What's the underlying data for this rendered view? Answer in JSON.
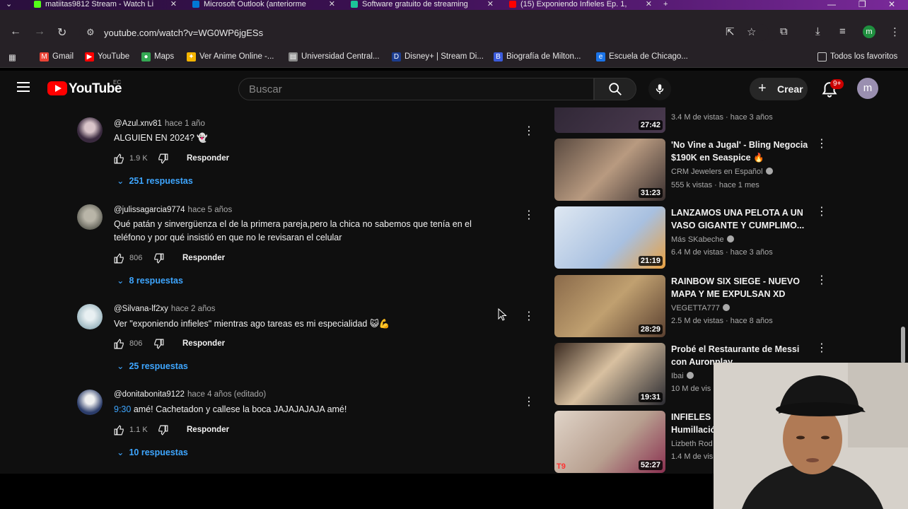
{
  "browser": {
    "tabs": [
      {
        "title": "matiitas9812 Stream - Watch Li",
        "color": "#53fc18"
      },
      {
        "title": "Microsoft Outlook (anteriorme",
        "color": "#0078d4"
      },
      {
        "title": "Software gratuito de streaming",
        "color": "#1cc49a"
      },
      {
        "title": "(15) Exponiendo Infieles Ep. 1,",
        "color": "#ff0000"
      }
    ],
    "url": "youtube.com/watch?v=WG0WP6jgESs",
    "profile_initial": "m",
    "bookmarks": [
      {
        "label": "Gmail",
        "color": "#ea4335"
      },
      {
        "label": "YouTube",
        "color": "#ff0000"
      },
      {
        "label": "Maps",
        "color": "#34a853"
      },
      {
        "label": "Ver Anime Online -...",
        "color": "#f4b400"
      },
      {
        "label": "Universidad Central...",
        "color": "#888888"
      },
      {
        "label": "Disney+ | Stream Di...",
        "color": "#1c3d8f"
      },
      {
        "label": "Biografía de Milton...",
        "color": "#3b5bdb"
      },
      {
        "label": "Escuela de Chicago...",
        "color": "#1a73e8"
      }
    ],
    "all_bookmarks": "Todos los favoritos"
  },
  "youtube": {
    "logo_text": "YouTube",
    "country": "EC",
    "search_placeholder": "Buscar",
    "create_label": "Crear",
    "notif_badge": "9+",
    "avatar_initial": "m"
  },
  "comments": [
    {
      "handle": "@Azul.xnv81",
      "ago": "hace 1 año",
      "text": "ALGUIEN EN 2024? 👻",
      "likes": "1.9 K",
      "reply": "Responder",
      "replies": "251 respuestas",
      "avatar": "#3a2a3f"
    },
    {
      "handle": "@julissagarcia9774",
      "ago": "hace 5 años",
      "text": "Qué patán y sinvergüenza el de la primera pareja,pero la chica no sabemos que tenía en el teléfono y por qué insistió en que no le revisaran el celular",
      "likes": "806",
      "reply": "Responder",
      "replies": "8 respuestas",
      "avatar": "#8a8a80"
    },
    {
      "handle": "@Silvana-lf2xy",
      "ago": "hace 2 años",
      "text": "Ver \"exponiendo infieles\" mientras ago tareas es mi especialidad 😺💪",
      "likes": "806",
      "reply": "Responder",
      "replies": "25 respuestas",
      "avatar": "#9fb9c2"
    },
    {
      "handle": "@donitabonita9122",
      "ago": "hace 4 años (editado)",
      "timestamp": "9:30",
      "text": " amé! Cachetadon y callese la boca JAJAJAJAJA amé!",
      "likes": "1.1 K",
      "reply": "Responder",
      "replies": "10 respuestas",
      "avatar": "#2b3c6a"
    }
  ],
  "videos": [
    {
      "title": "",
      "channel": "",
      "meta": "3.4 M de vistas · hace 3 años",
      "duration": "27:42",
      "thumb": "#3b3340"
    },
    {
      "title": "'No Vine a Jugal' - Bling Negocia $190K en Seaspice 🔥",
      "channel": "CRM Jewelers en Español",
      "meta": "555 k vistas · hace 1 mes",
      "duration": "31:23",
      "thumb": "#6a5a50"
    },
    {
      "title": "LANZAMOS UNA PELOTA A UN VASO GIGANTE Y CUMPLIMO...",
      "channel": "Más SKabeche",
      "meta": "6.4 M de vistas · hace 3 años",
      "duration": "21:19",
      "thumb": "#c9d6e8"
    },
    {
      "title": "RAINBOW SIX SIEGE - NUEVO MAPA Y ME EXPULSAN XD",
      "channel": "VEGETTA777",
      "meta": "2.5 M de vistas · hace 8 años",
      "duration": "28:29",
      "thumb": "#7a5a3a"
    },
    {
      "title": "Probé el Restaurante de Messi con Auronplay",
      "channel": "Ibai",
      "meta": "10 M de vis",
      "duration": "19:31",
      "thumb": "#4a3a2a"
    },
    {
      "title": "INFIELES Humillació",
      "channel": "Lizbeth Rod",
      "meta": "1.4 M de vis",
      "duration": "52:27",
      "thumb": "#c8b8a8",
      "badge": "T9"
    }
  ]
}
